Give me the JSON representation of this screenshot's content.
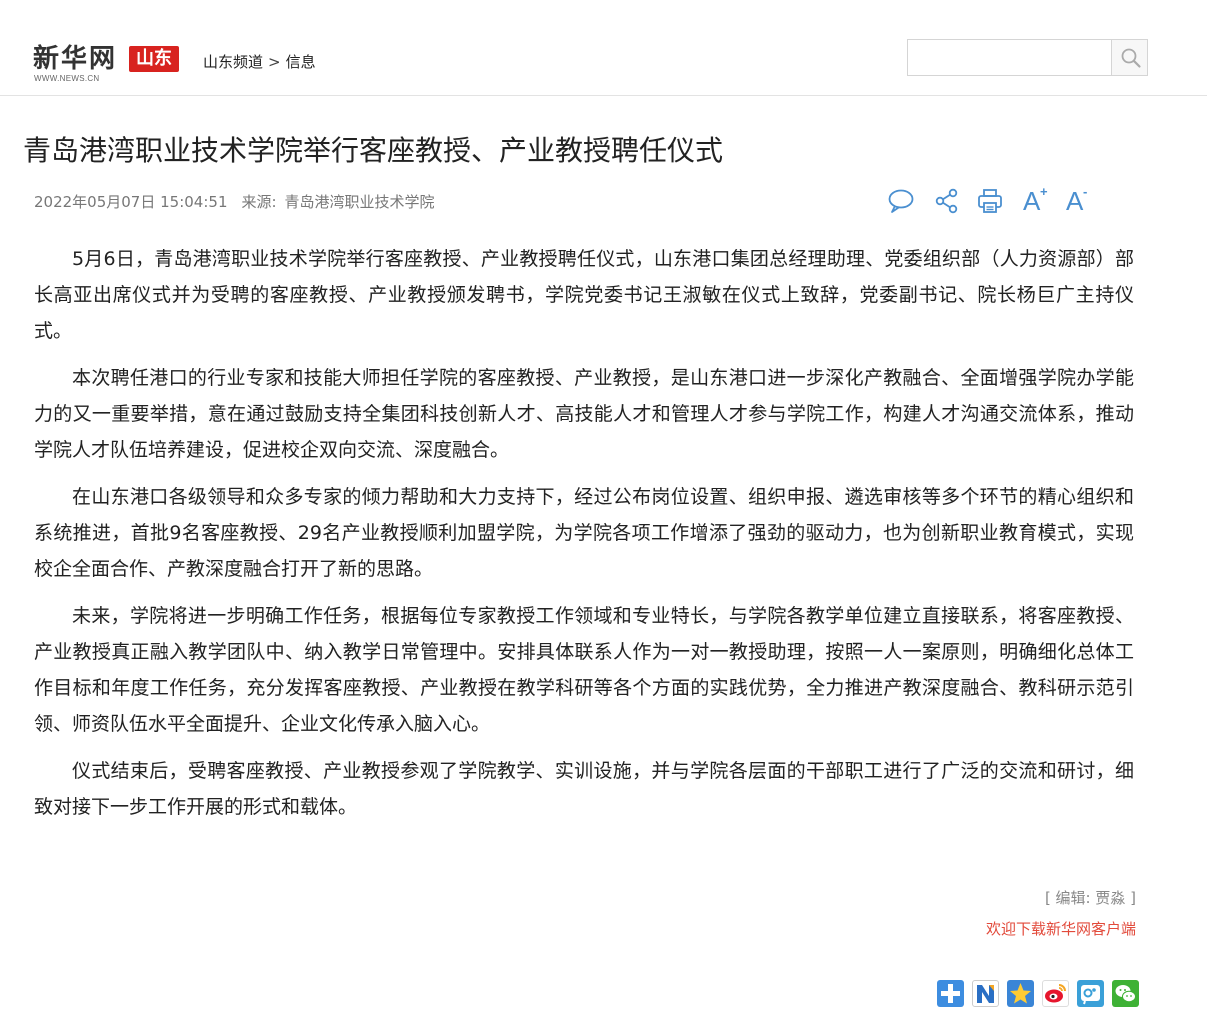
{
  "header": {
    "logo_text": "新华网",
    "logo_badge": "山东",
    "logo_url_text": "WWW.NEWS.CN",
    "breadcrumb": {
      "channel": "山东频道",
      "separator": ">",
      "section": "信息"
    },
    "search": {
      "placeholder": "",
      "button_icon": "search-icon"
    }
  },
  "article": {
    "title": "青岛港湾职业技术学院举行客座教授、产业教授聘任仪式",
    "datetime": "2022年05月07日 15:04:51",
    "source_label": "来源:",
    "source": "青岛港湾职业技术学院",
    "paragraphs": [
      "5月6日，青岛港湾职业技术学院举行客座教授、产业教授聘任仪式，山东港口集团总经理助理、党委组织部（人力资源部）部长高亚出席仪式并为受聘的客座教授、产业教授颁发聘书，学院党委书记王淑敏在仪式上致辞，党委副书记、院长杨巨广主持仪式。",
      "本次聘任港口的行业专家和技能大师担任学院的客座教授、产业教授，是山东港口进一步深化产教融合、全面增强学院办学能力的又一重要举措，意在通过鼓励支持全集团科技创新人才、高技能人才和管理人才参与学院工作，构建人才沟通交流体系，推动学院人才队伍培养建设，促进校企双向交流、深度融合。",
      "在山东港口各级领导和众多专家的倾力帮助和大力支持下，经过公布岗位设置、组织申报、遴选审核等多个环节的精心组织和系统推进，首批9名客座教授、29名产业教授顺利加盟学院，为学院各项工作增添了强劲的驱动力，也为创新职业教育模式，实现校企全面合作、产教深度融合打开了新的思路。",
      "未来，学院将进一步明确工作任务，根据每位专家教授工作领域和专业特长，与学院各教学单位建立直接联系，将客座教授、产业教授真正融入教学团队中、纳入教学日常管理中。安排具体联系人作为一对一教授助理，按照一人一案原则，明确细化总体工作目标和年度工作任务，充分发挥客座教授、产业教授在教学科研等各个方面的实践优势，全力推进产教深度融合、教科研示范引领、师资队伍水平全面提升、企业文化传承入脑入心。",
      "仪式结束后，受聘客座教授、产业教授参观了学院教学、实训设施，并与学院各层面的干部职工进行了广泛的交流和研讨，细致对接下一步工作开展的形式和载体。"
    ],
    "editor": "[ 编辑:  贾淼 ]",
    "download_link": "欢迎下载新华网客户端"
  },
  "tools": [
    {
      "icon": "comment-icon"
    },
    {
      "icon": "share-icon"
    },
    {
      "icon": "print-icon"
    },
    {
      "icon": "font-increase-icon",
      "letter": "A",
      "sign": "+"
    },
    {
      "icon": "font-decrease-icon",
      "letter": "A",
      "sign": "-"
    }
  ],
  "share_buttons": [
    {
      "icon": "more-share-icon",
      "color": "#3d8de0"
    },
    {
      "icon": "netease-icon",
      "color": "#2a6fc4"
    },
    {
      "icon": "qzone-icon",
      "color": "#3a85d6"
    },
    {
      "icon": "weibo-icon",
      "color": "#e6162d"
    },
    {
      "icon": "tencent-weibo-icon",
      "color": "#3aa0d8"
    },
    {
      "icon": "wechat-icon",
      "color": "#3eb135"
    }
  ],
  "colors": {
    "accent_blue": "#4a8fd0",
    "brand_red": "#d8231f",
    "download_red": "#e24a3b"
  }
}
